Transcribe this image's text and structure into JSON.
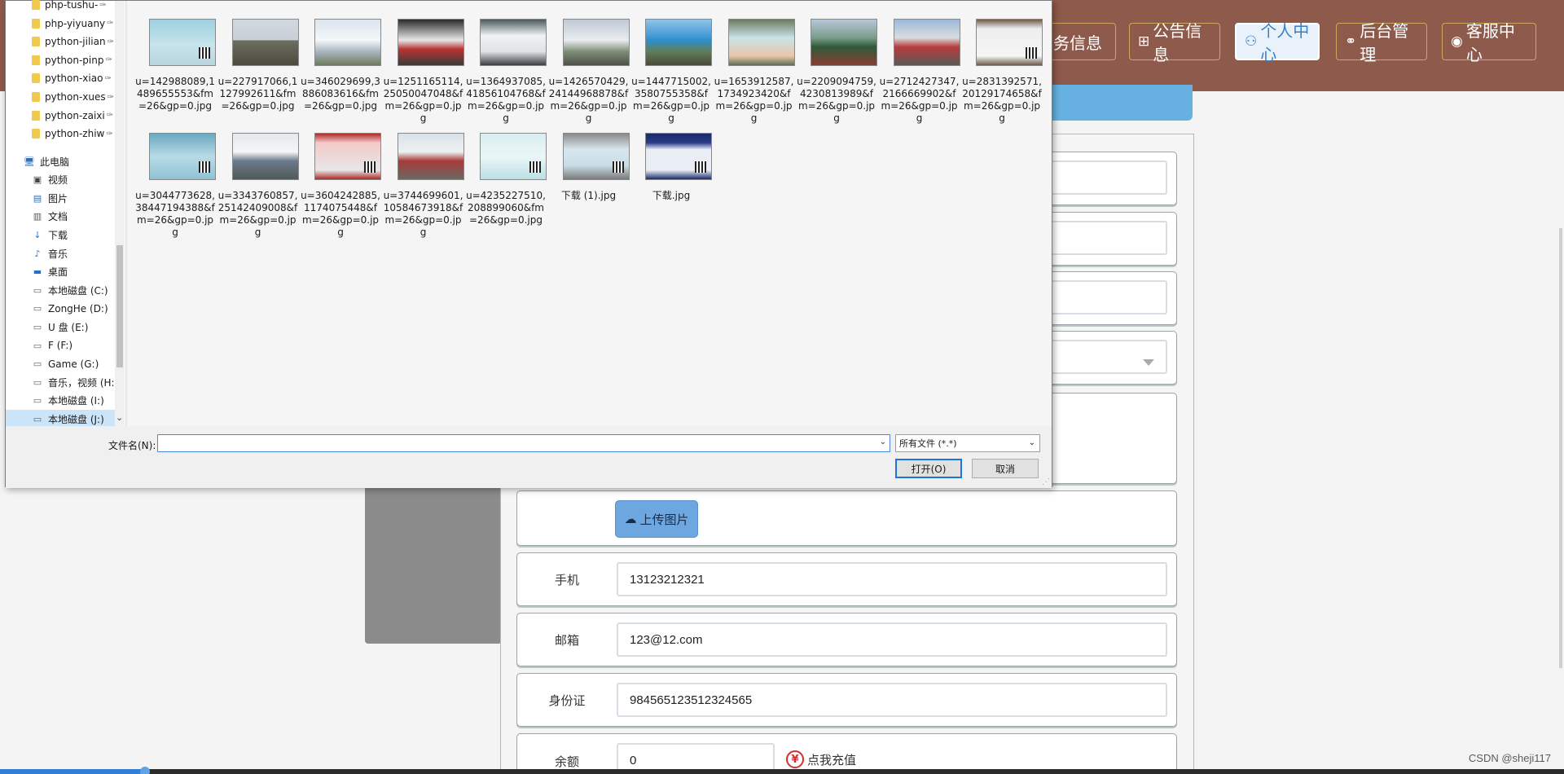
{
  "topnav": {
    "items": [
      {
        "label": "票务信息",
        "icon": "ticket-icon"
      },
      {
        "label": "公告信息",
        "icon": "gift-icon"
      },
      {
        "label": "个人中心",
        "icon": "user-icon",
        "active": true
      },
      {
        "label": "后台管理",
        "icon": "link-icon"
      },
      {
        "label": "客服中心",
        "icon": "chat-icon"
      }
    ]
  },
  "form": {
    "upload_label": "上传图片",
    "phone_label": "手机",
    "phone_value": "13123212321",
    "email_label": "邮箱",
    "email_value": "123@12.com",
    "idcard_label": "身份证",
    "idcard_value": "984565123512324565",
    "balance_label": "余额",
    "balance_value": "0",
    "recharge_label": "点我充值",
    "recharge_icon": "¥"
  },
  "watermark": "CSDN @sheji117",
  "dialog": {
    "nav_items": [
      {
        "label": "php-tushu-",
        "icon": "folder-icon",
        "pinned": true
      },
      {
        "label": "php-yiyuany",
        "icon": "folder-icon",
        "pinned": true
      },
      {
        "label": "python-jilian",
        "icon": "folder-icon",
        "pinned": true
      },
      {
        "label": "python-pinp",
        "icon": "folder-icon",
        "pinned": true
      },
      {
        "label": "python-xiao",
        "icon": "folder-icon",
        "pinned": true
      },
      {
        "label": "python-xues",
        "icon": "folder-icon",
        "pinned": true
      },
      {
        "label": "python-zaixi",
        "icon": "folder-icon",
        "pinned": true
      },
      {
        "label": "python-zhiw",
        "icon": "folder-icon",
        "pinned": true
      },
      {
        "label": "此电脑",
        "icon": "computer-icon"
      },
      {
        "label": "视频",
        "icon": "video-icon"
      },
      {
        "label": "图片",
        "icon": "picture-icon"
      },
      {
        "label": "文档",
        "icon": "document-icon"
      },
      {
        "label": "下载",
        "icon": "download-icon"
      },
      {
        "label": "音乐",
        "icon": "music-icon"
      },
      {
        "label": "桌面",
        "icon": "desktop-icon"
      },
      {
        "label": "本地磁盘 (C:)",
        "icon": "drive-icon"
      },
      {
        "label": "ZongHe (D:)",
        "icon": "drive-icon"
      },
      {
        "label": "U 盘 (E:)",
        "icon": "drive-icon"
      },
      {
        "label": "F (F:)",
        "icon": "drive-icon"
      },
      {
        "label": "Game (G:)",
        "icon": "drive-icon"
      },
      {
        "label": "音乐，视频 (H:)",
        "icon": "drive-icon"
      },
      {
        "label": "本地磁盘 (I:)",
        "icon": "drive-icon"
      },
      {
        "label": "本地磁盘 (J:)",
        "icon": "drive-icon",
        "selected": true
      }
    ],
    "files": [
      {
        "name": "u=142988089,1489655553&fm=26&gp=0.jpg",
        "thumb": "t-ticket"
      },
      {
        "name": "u=227917066,1127992611&fm=26&gp=0.jpg",
        "thumb": "t-train1"
      },
      {
        "name": "u=346029699,3886083616&fm=26&gp=0.jpg",
        "thumb": "t-train2"
      },
      {
        "name": "u=1251165114,25050047048&fm=26&gp=0.jpg",
        "thumb": "t-train3"
      },
      {
        "name": "u=1364937085,41856104768&fm=26&gp=0.jpg",
        "thumb": "t-train4"
      },
      {
        "name": "u=1426570429,24144968878&fm=26&gp=0.jpg",
        "thumb": "t-train5"
      },
      {
        "name": "u=1447715002,3580755358&fm=26&gp=0.jpg",
        "thumb": "t-train6"
      },
      {
        "name": "u=1653912587,1734923420&fm=26&gp=0.jpg",
        "thumb": "t-hand"
      },
      {
        "name": "u=2209094759,4230813989&fm=26&gp=0.jpg",
        "thumb": "t-loco"
      },
      {
        "name": "u=2712427347,2166669902&fm=26&gp=0.jpg",
        "thumb": "t-train7"
      },
      {
        "name": "u=2831392571,20129174658&fm=26&gp=0.jpg",
        "thumb": "t-ticket2"
      },
      {
        "name": "u=3044773628,38447194388&fm=26&gp=0.jpg",
        "thumb": "t-ticket3"
      },
      {
        "name": "u=3343760857,25142409008&fm=26&gp=0.jpg",
        "thumb": "t-train8"
      },
      {
        "name": "u=3604242885,1174075448&fm=26&gp=0.jpg",
        "thumb": "t-ticket4"
      },
      {
        "name": "u=3744699601,10584673918&fm=26&gp=0.jpg",
        "thumb": "t-train9"
      },
      {
        "name": "u=4235227510,208899060&fm=26&gp=0.jpg",
        "thumb": "t-ticket5"
      },
      {
        "name": "下载 (1).jpg",
        "thumb": "t-ticket6"
      },
      {
        "name": "下载.jpg",
        "thumb": "t-ticket7"
      }
    ],
    "filename_label": "文件名(N):",
    "filename_value": "",
    "filetype_value": "所有文件 (*.*)",
    "open_label": "打开(O)",
    "cancel_label": "取消"
  }
}
